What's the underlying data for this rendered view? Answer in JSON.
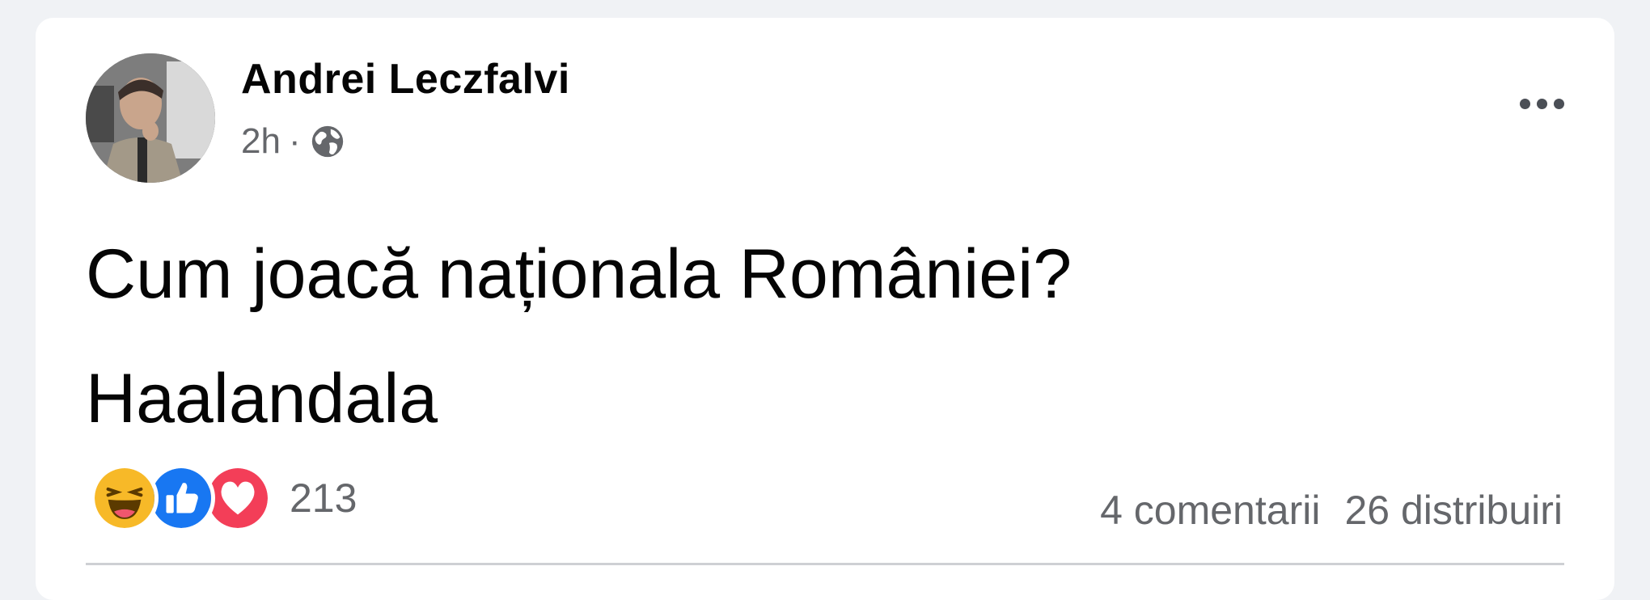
{
  "post": {
    "author_name": "Andrei Leczfalvi",
    "time": "2h",
    "separator": "·",
    "privacy_icon": "globe-icon",
    "more_icon": "more-options-icon",
    "text_line_1": "Cum joacă naționala României?",
    "text_line_2": "Haalandala"
  },
  "reactions": {
    "icons": [
      "haha-icon",
      "like-icon",
      "love-icon"
    ],
    "count": "213"
  },
  "stats": {
    "comments": "4 comentarii",
    "shares": "26 distribuiri"
  },
  "colors": {
    "haha": "#f7b928",
    "like": "#1877f2",
    "love": "#f33e58",
    "secondary_text": "#65676b",
    "background": "#f0f2f5"
  }
}
